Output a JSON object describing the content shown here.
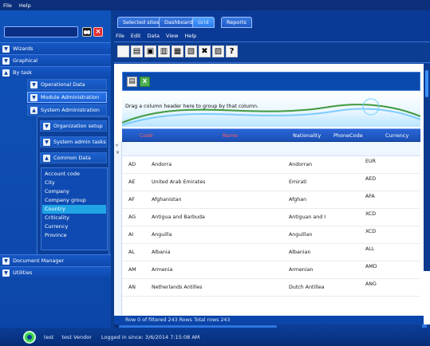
{
  "menu": {
    "file": "File",
    "help": "Help"
  },
  "left": {
    "search": {
      "placeholder": ""
    },
    "sections": {
      "wizards": "Wizards",
      "graphical": "Graphical",
      "by_task": "By task",
      "document_manager": "Document Manager",
      "utilities": "Utilities"
    },
    "by_task_items": {
      "operational": "Operational Data",
      "module_admin": "Module Administration",
      "system_admin": "System Administration"
    },
    "system_admin_items": {
      "org_setup": "Organization setup",
      "system_tasks": "System admin tasks",
      "common_data": "Common Data"
    },
    "common_data_items": [
      "Account code",
      "City",
      "Company",
      "Company group",
      "Country",
      "Criticality",
      "Currency",
      "Province"
    ],
    "active_common_item": "Country"
  },
  "tabs": {
    "selected_sites": "Selected sites",
    "dashboard": "Dashboard",
    "active": "Grid",
    "reports": "Reports"
  },
  "main_menu": {
    "file": "File",
    "edit": "Edit",
    "data": "Data",
    "view": "View",
    "help": "Help"
  },
  "grid": {
    "group_hint": "Drag a column header here to group by that column.",
    "columns": [
      "Code",
      "Name",
      "Nationality",
      "PhoneCode",
      "Currency"
    ],
    "rows": [
      {
        "code": "AD",
        "name": "Andorra",
        "nationality": "Andorran",
        "phone": "",
        "currency": "EUR"
      },
      {
        "code": "AE",
        "name": "United Arab Emirates",
        "nationality": "Emirati",
        "phone": "",
        "currency": "AED"
      },
      {
        "code": "AF",
        "name": "Afghanistan",
        "nationality": "Afghan",
        "phone": "",
        "currency": "AFA"
      },
      {
        "code": "AG",
        "name": "Antigua and Barbuda",
        "nationality": "Antiguan and I",
        "phone": "",
        "currency": "XCD"
      },
      {
        "code": "AI",
        "name": "Anguilla",
        "nationality": "Anguillan",
        "phone": "",
        "currency": "XCD"
      },
      {
        "code": "AL",
        "name": "Albania",
        "nationality": "Albanian",
        "phone": "",
        "currency": "ALL"
      },
      {
        "code": "AM",
        "name": "Armenia",
        "nationality": "Armenian",
        "phone": "",
        "currency": "AMD"
      },
      {
        "code": "AN",
        "name": "Netherlands Antilles",
        "nationality": "Dutch Antillea",
        "phone": "",
        "currency": "ANG"
      }
    ],
    "status": "Row 0 of filtered 243 Rows   Total rows 243"
  },
  "footer": {
    "user": "test",
    "vendor": "test Vendor",
    "login": "Logged in since: 3/6/2014 7:15:08 AM"
  }
}
